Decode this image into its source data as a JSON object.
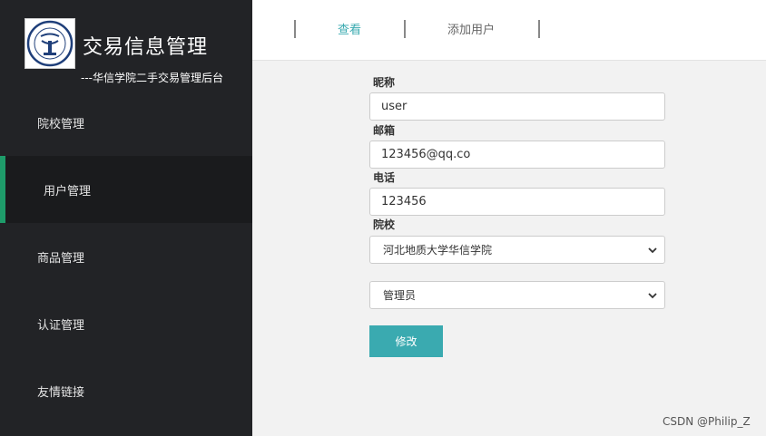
{
  "app": {
    "title": "交易信息管理",
    "subtitle": "---华信学院二手交易管理后台"
  },
  "sidebar": {
    "items": [
      {
        "label": "院校管理",
        "active": false
      },
      {
        "label": "用户管理",
        "active": true
      },
      {
        "label": "商品管理",
        "active": false
      },
      {
        "label": "认证管理",
        "active": false
      },
      {
        "label": "友情链接",
        "active": false
      }
    ]
  },
  "tabs": [
    {
      "label": "查看",
      "active": true
    },
    {
      "label": "添加用户",
      "active": false
    }
  ],
  "form": {
    "nickname": {
      "label": "昵称",
      "value": "user"
    },
    "email": {
      "label": "邮箱",
      "value": "123456@qq.co"
    },
    "phone": {
      "label": "电话",
      "value": "123456"
    },
    "school": {
      "label": "院校",
      "value": "河北地质大学华信学院"
    },
    "role": {
      "value": "管理员"
    },
    "submit_label": "修改"
  },
  "watermark": "CSDN @Philip_Z",
  "colors": {
    "sidebar_bg": "#222326",
    "accent": "#3aaab0",
    "active_marker": "#1e9c6a"
  }
}
